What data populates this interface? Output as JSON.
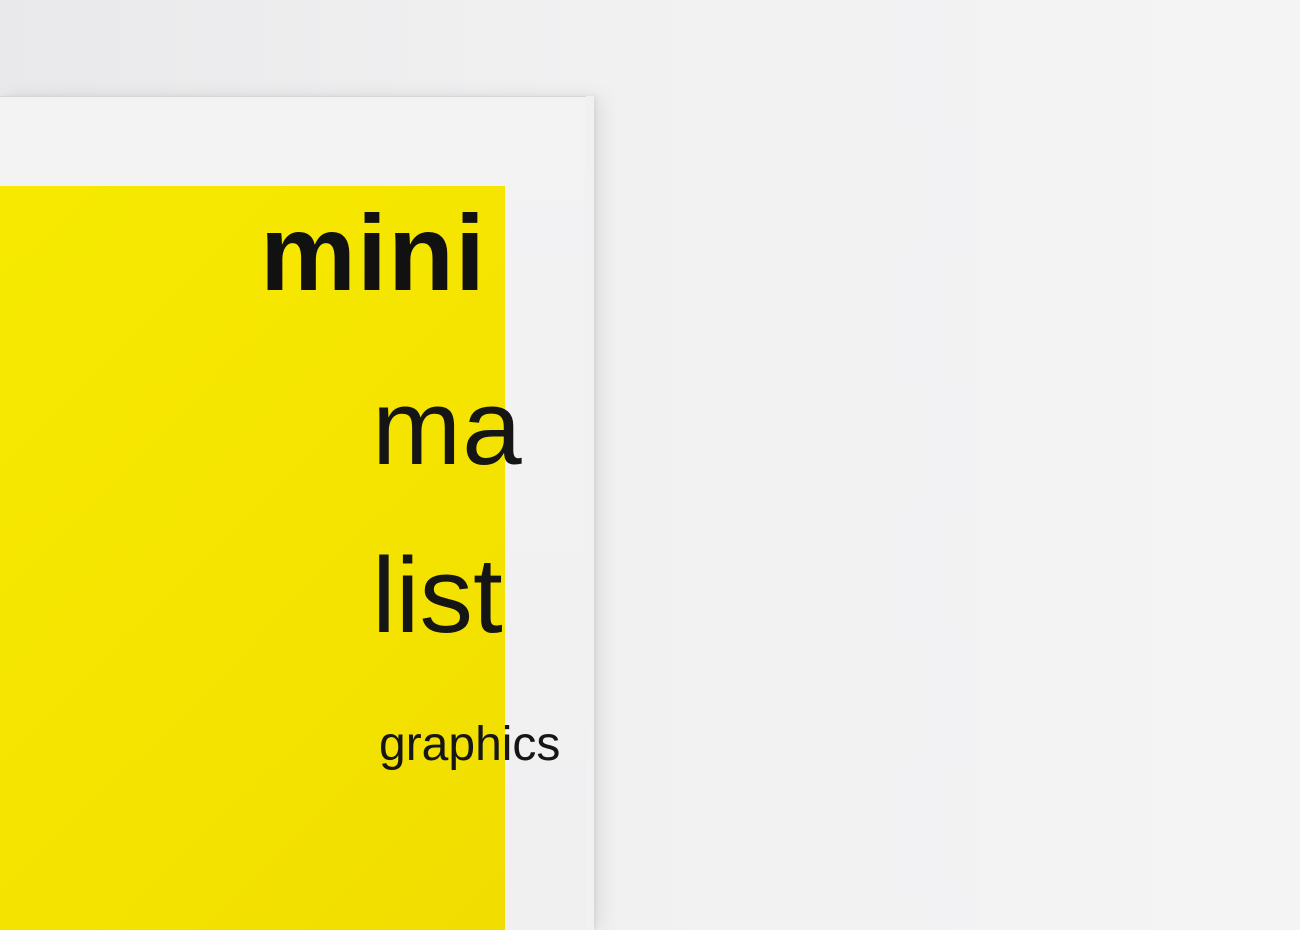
{
  "cover": {
    "title_lines": [
      "mini",
      "ma",
      "list"
    ],
    "subtitle": "graphics"
  },
  "colors": {
    "background": "#f2f2f3",
    "cover_white": "#f1f1f2",
    "accent_yellow": "#f5e600",
    "text": "#151515"
  }
}
